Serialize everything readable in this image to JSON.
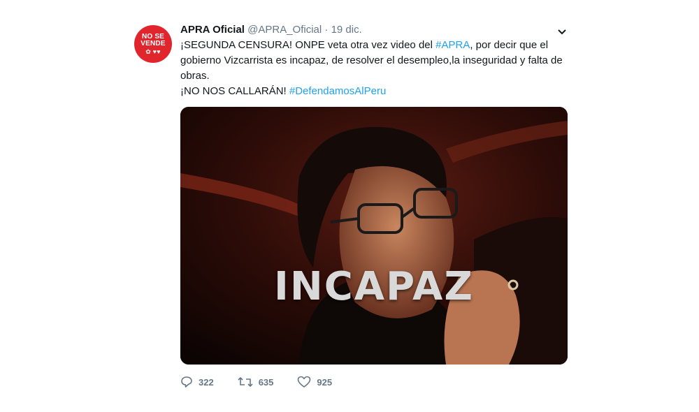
{
  "tweet": {
    "avatar_text_line1": "NO SE",
    "avatar_text_line2": "VENDE",
    "display_name": "APRA Oficial",
    "handle": "@APRA_Oficial",
    "separator": "·",
    "date": "19 dic.",
    "line1_pre": "¡SEGUNDA CENSURA!  ONPE veta otra vez video del ",
    "line1_hashtag": "#APRA",
    "line1_post": ", por decir que el gobierno  Vizcarrista es incapaz, de resolver el desempleo,la inseguridad y falta de obras.",
    "line2_pre": "¡NO NOS CALLARÁN!  ",
    "line2_hashtag": "#DefendamosAlPeru",
    "media_caption": "INCAPAZ",
    "replies": "322",
    "retweets": "635",
    "likes": "925"
  },
  "icons": {
    "menu": "chevron-down-icon",
    "reply": "reply-icon",
    "retweet": "retweet-icon",
    "like": "heart-icon"
  },
  "colors": {
    "avatar_bg": "#e0262c",
    "hashtag": "#1da1f2",
    "meta_text": "#657786"
  }
}
